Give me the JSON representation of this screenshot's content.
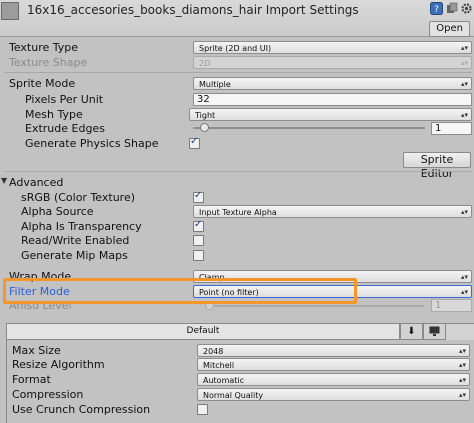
{
  "header": {
    "title": "16x16_accesories_books_diamons_hair Import Settings",
    "open_label": "Open",
    "icons": [
      "help-icon",
      "preset-icon",
      "settings-gear-icon"
    ]
  },
  "texture_type": {
    "label": "Texture Type",
    "value": "Sprite (2D and UI)"
  },
  "texture_shape": {
    "label": "Texture Shape",
    "value": "2D"
  },
  "sprite_mode": {
    "label": "Sprite Mode",
    "value": "Multiple"
  },
  "pixels_per_unit": {
    "label": "Pixels Per Unit",
    "value": "32"
  },
  "mesh_type": {
    "label": "Mesh Type",
    "value": "Tight"
  },
  "extrude_edges": {
    "label": "Extrude Edges",
    "value": "1",
    "slider_fraction": 0.03
  },
  "physics_shape": {
    "label": "Generate Physics Shape",
    "checked": true
  },
  "sprite_editor": {
    "label": "Sprite Editor"
  },
  "advanced": {
    "label": "Advanced",
    "srgb": {
      "label": "sRGB (Color Texture)",
      "checked": true
    },
    "alpha_source": {
      "label": "Alpha Source",
      "value": "Input Texture Alpha"
    },
    "alpha_transparency": {
      "label": "Alpha Is Transparency",
      "checked": true
    },
    "read_write": {
      "label": "Read/Write Enabled",
      "checked": false
    },
    "mip_maps": {
      "label": "Generate Mip Maps",
      "checked": false
    }
  },
  "wrap_mode": {
    "label": "Wrap Mode",
    "value": "Clamp"
  },
  "filter_mode": {
    "label": "Filter Mode",
    "value": "Point (no filter)"
  },
  "aniso_level": {
    "label": "Aniso Level",
    "value": "1",
    "slider_fraction": 0.0
  },
  "platform": {
    "tab_default": "Default",
    "tab_icons": [
      "download-icon",
      "monitor-icon"
    ],
    "max_size": {
      "label": "Max Size",
      "value": "2048"
    },
    "resize_algorithm": {
      "label": "Resize Algorithm",
      "value": "Mitchell"
    },
    "format": {
      "label": "Format",
      "value": "Automatic"
    },
    "compression": {
      "label": "Compression",
      "value": "Normal Quality"
    },
    "crunch": {
      "label": "Use Crunch Compression",
      "checked": false
    }
  },
  "colors": {
    "highlight": "#f5962b",
    "focused_label": "#2b5fd9",
    "focused_border": "#3a68d8",
    "checkmark": "#1e3c8c"
  }
}
